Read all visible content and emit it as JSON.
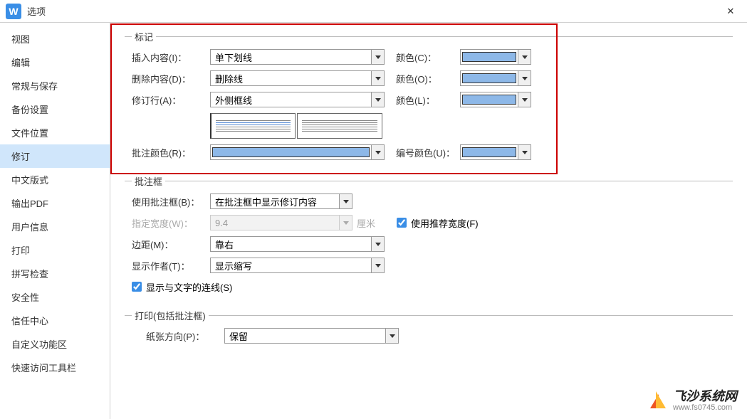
{
  "window": {
    "title": "选项",
    "close_icon": "✕"
  },
  "sidebar": {
    "items": [
      {
        "label": "视图"
      },
      {
        "label": "编辑"
      },
      {
        "label": "常规与保存"
      },
      {
        "label": "备份设置"
      },
      {
        "label": "文件位置"
      },
      {
        "label": "修订",
        "active": true
      },
      {
        "label": "中文版式"
      },
      {
        "label": "输出PDF"
      },
      {
        "label": "用户信息"
      },
      {
        "label": "打印"
      },
      {
        "label": "拼写检查"
      },
      {
        "label": "安全性"
      },
      {
        "label": "信任中心"
      },
      {
        "label": "自定义功能区"
      },
      {
        "label": "快速访问工具栏"
      }
    ]
  },
  "mark": {
    "legend": "标记",
    "insert_label": "插入内容(I)：",
    "insert_value": "单下划线",
    "insert_color_label": "颜色(C)：",
    "delete_label": "删除内容(D)：",
    "delete_value": "删除线",
    "delete_color_label": "颜色(O)：",
    "revise_label": "修订行(A)：",
    "revise_value": "外侧框线",
    "revise_color_label": "颜色(L)：",
    "comment_color_label": "批注颜色(R)：",
    "number_color_label": "编号颜色(U)：",
    "swatch_color": "#8db8e8"
  },
  "balloon": {
    "legend": "批注框",
    "use_label": "使用批注框(B)：",
    "use_value": "在批注框中显示修订内容",
    "width_label": "指定宽度(W)：",
    "width_value": "9.4",
    "width_unit": "厘米",
    "recommended_label": "使用推荐宽度(F)",
    "recommended_checked": true,
    "margin_label": "边距(M)：",
    "margin_value": "靠右",
    "author_label": "显示作者(T)：",
    "author_value": "显示缩写",
    "show_lines_label": "显示与文字的连线(S)",
    "show_lines_checked": true
  },
  "print": {
    "legend": "打印(包括批注框)",
    "orient_label": "纸张方向(P)：",
    "orient_value": "保留"
  },
  "watermark": {
    "main": "飞沙系统网",
    "sub": "www.fs0745.com"
  }
}
